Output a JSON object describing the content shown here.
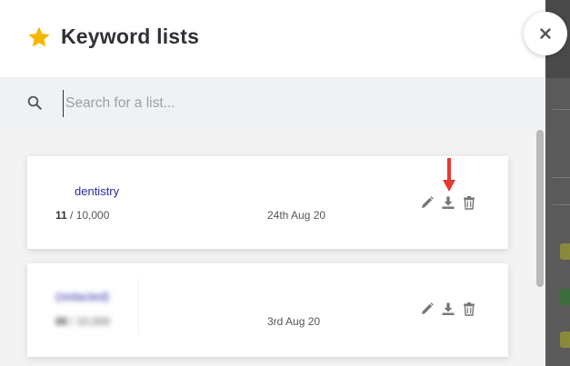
{
  "header": {
    "title": "Keyword lists",
    "star_icon": "star-icon",
    "close_icon": "close-icon"
  },
  "search": {
    "placeholder": "Search for a list...",
    "value": ""
  },
  "lists": [
    {
      "name": "dentistry",
      "count_used": "11",
      "count_sep": " / ",
      "count_max": "10,000",
      "date": "24th Aug 20"
    },
    {
      "name": "(redacted)",
      "count_used": "00",
      "count_sep": " / ",
      "count_max": "10,000",
      "date": "3rd Aug 20"
    }
  ],
  "actions": [
    "edit-icon",
    "download-icon",
    "trash-icon"
  ],
  "colors": {
    "accent_star": "#f5b800",
    "list_name": "#2a2aa8",
    "annotation_arrow": "#e53935",
    "search_bg": "#eef2f5"
  }
}
